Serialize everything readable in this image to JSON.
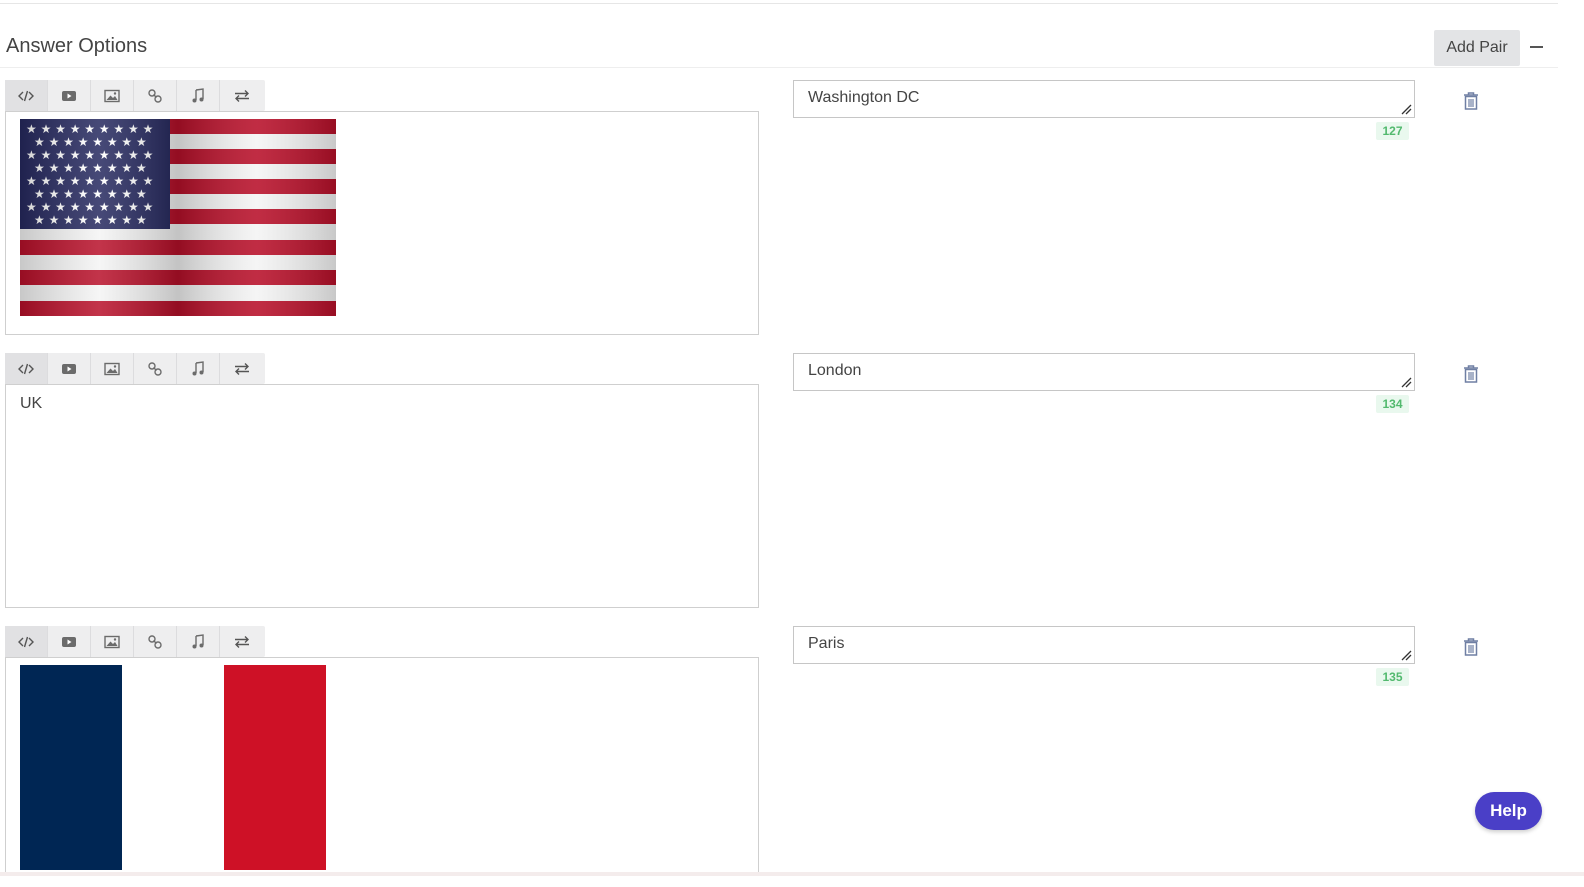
{
  "header": {
    "title": "Answer Options",
    "add_pair_label": "Add Pair",
    "collapse_icon": "minus-icon"
  },
  "toolbar_icons": [
    "code-icon",
    "video-icon",
    "image-icon",
    "link-icon",
    "audio-icon",
    "swap-icon"
  ],
  "pairs": [
    {
      "option_content": "image",
      "option_text": "",
      "flag": "usa-flag",
      "answer": "Washington DC",
      "char_count": "127"
    },
    {
      "option_content": "text",
      "option_text": "UK",
      "flag": "",
      "answer": "London",
      "char_count": "134"
    },
    {
      "option_content": "image",
      "option_text": "",
      "flag": "france-flag",
      "answer": "Paris",
      "char_count": "135"
    }
  ],
  "help_label": "Help",
  "colors": {
    "accent": "#4a3fc7",
    "counter_text": "#52b96e",
    "counter_bg": "#e9f8ee",
    "flag_blue_us": "#26295f",
    "flag_red_us": "#b8102a",
    "flag_blue_fr": "#002654",
    "flag_red_fr": "#ce1126"
  }
}
